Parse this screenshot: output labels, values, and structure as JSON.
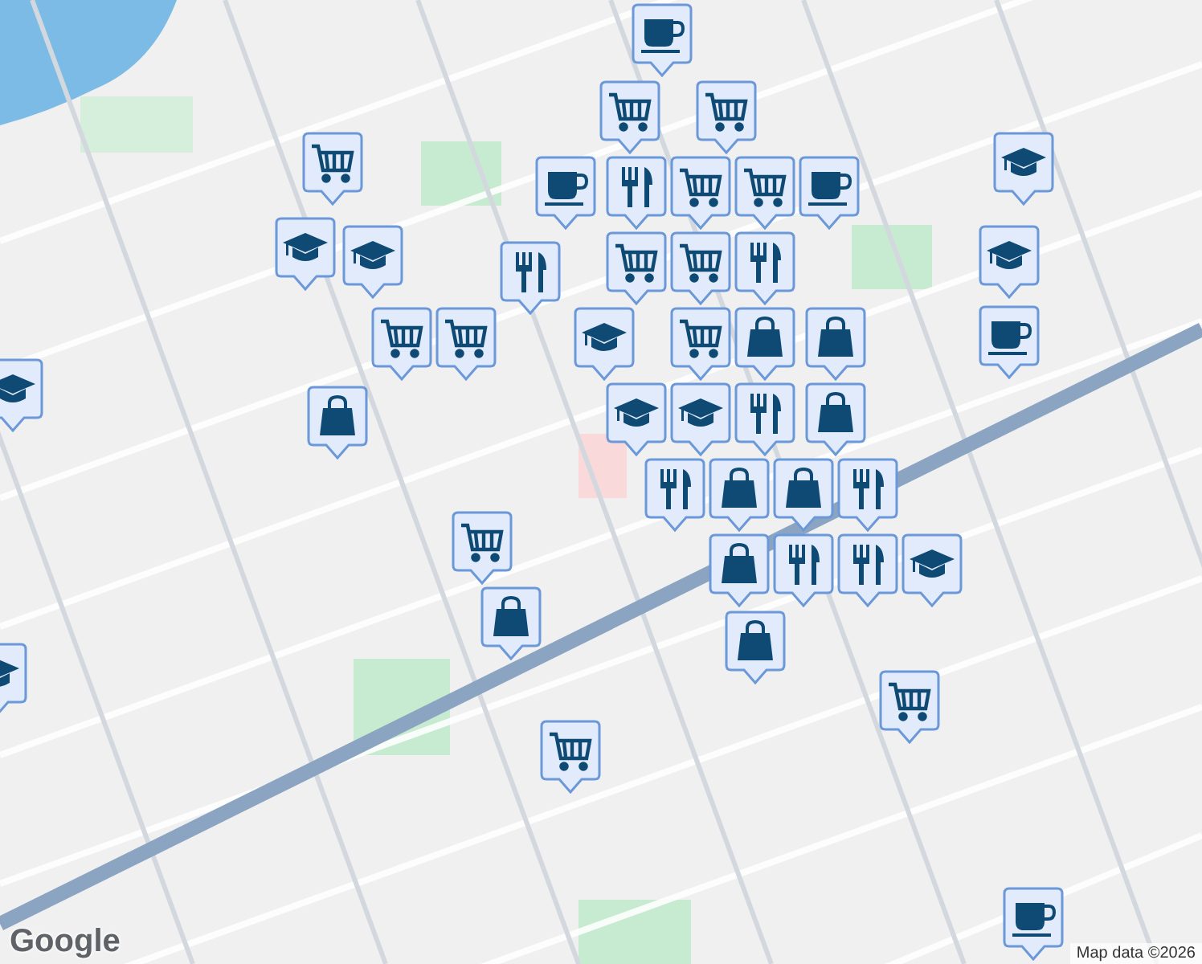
{
  "map": {
    "pins": [
      {
        "kind": "cup"
      },
      {
        "kind": "cart"
      },
      {
        "kind": "cart"
      },
      {
        "kind": "cup"
      },
      {
        "kind": "fork"
      },
      {
        "kind": "cart"
      },
      {
        "kind": "cart"
      },
      {
        "kind": "cart"
      },
      {
        "kind": "cup"
      },
      {
        "kind": "fork"
      },
      {
        "kind": "cart"
      },
      {
        "kind": "cart"
      },
      {
        "kind": "cap"
      },
      {
        "kind": "cap"
      },
      {
        "kind": "fork"
      },
      {
        "kind": "cart"
      },
      {
        "kind": "cart"
      },
      {
        "kind": "cap"
      },
      {
        "kind": "cart"
      },
      {
        "kind": "bag"
      },
      {
        "kind": "bag"
      },
      {
        "kind": "bag"
      },
      {
        "kind": "cap"
      },
      {
        "kind": "cap"
      },
      {
        "kind": "bag"
      },
      {
        "kind": "cap"
      },
      {
        "kind": "fork"
      },
      {
        "kind": "bag"
      },
      {
        "kind": "fork"
      },
      {
        "kind": "bag"
      },
      {
        "kind": "cap"
      },
      {
        "kind": "cap"
      },
      {
        "kind": "cup"
      },
      {
        "kind": "bag"
      },
      {
        "kind": "fork"
      },
      {
        "kind": "fork"
      },
      {
        "kind": "fork"
      },
      {
        "kind": "cap"
      },
      {
        "kind": "cart"
      },
      {
        "kind": "bag"
      },
      {
        "kind": "bag"
      },
      {
        "kind": "cart"
      },
      {
        "kind": "cart"
      },
      {
        "kind": "cup"
      },
      {
        "kind": "cap"
      }
    ]
  },
  "logo": "Google",
  "attribution": "Map data ©2026"
}
